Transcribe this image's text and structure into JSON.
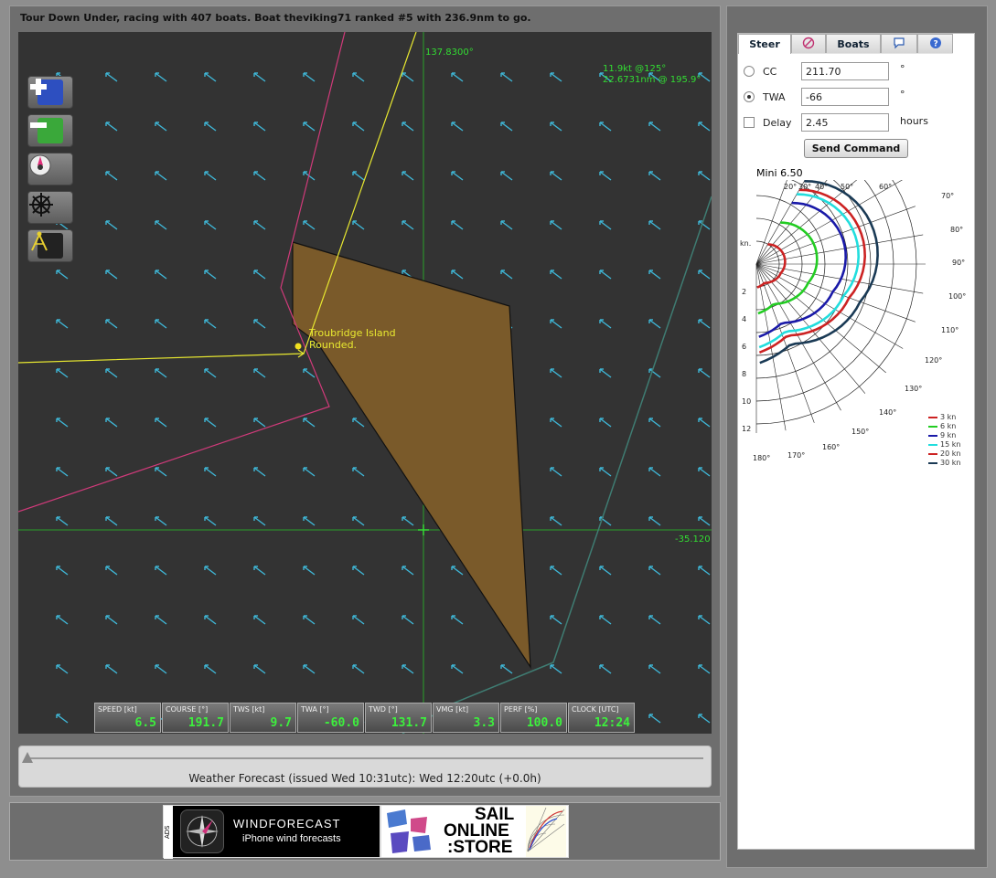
{
  "status": {
    "text": "Tour Down Under, racing with 407 boats. Boat theviking71 ranked #5 with 236.9nm to go."
  },
  "map": {
    "lon_label": "137.8300°",
    "lat_label": "-35.120",
    "wind_info_line1": "11.9kt @125°",
    "wind_info_line2": "22.6731nm @ 195.9°",
    "mark_label_line1": "Troubridge Island",
    "mark_label_line2": "Rounded.",
    "controls": [
      "zoom-in-icon",
      "zoom-out-icon",
      "compass-icon",
      "helm-wheel-icon",
      "divider-measure-icon"
    ]
  },
  "instruments": [
    {
      "label": "SPEED [kt]",
      "value": "6.5"
    },
    {
      "label": "COURSE [°]",
      "value": "191.7"
    },
    {
      "label": "TWS [kt]",
      "value": "9.7"
    },
    {
      "label": "TWA [°]",
      "value": "-60.0"
    },
    {
      "label": "TWD [°]",
      "value": "131.7"
    },
    {
      "label": "VMG [kt]",
      "value": "3.3"
    },
    {
      "label": "PERF [%]",
      "value": "100.0"
    },
    {
      "label": "CLOCK [UTC]",
      "value": "12:24"
    }
  ],
  "forecast": {
    "text": "Weather Forecast  (issued Wed 10:31utc): Wed 12:20utc  (+0.0h)"
  },
  "ads": {
    "wind_side_label": "ADS",
    "wind_title": "WINDFORECAST",
    "wind_subtitle": "iPhone wind forecasts",
    "sail_line1": "SAIL",
    "sail_line2": "ONLINE",
    "sail_line3": ":STORE"
  },
  "steer": {
    "tabs": {
      "steer": "Steer",
      "boats": "Boats"
    },
    "cc_label": "CC",
    "cc_value": "211.70",
    "twa_label": "TWA",
    "twa_value": "-66",
    "degree_unit": "°",
    "delay_label": "Delay",
    "delay_value": "2.45",
    "delay_unit": "hours",
    "send_button": "Send Command",
    "selected_mode": "TWA"
  },
  "polar": {
    "title": "Mini 6.50",
    "speed_axis_label": "kn.",
    "speed_ticks": [
      "2",
      "4",
      "6",
      "8",
      "10",
      "12"
    ],
    "angle_ticks": [
      "20°",
      "30°",
      "40°",
      "50°",
      "60°",
      "70°",
      "80°",
      "90°",
      "100°",
      "110°",
      "120°",
      "130°",
      "140°",
      "150°",
      "160°",
      "170°",
      "180°"
    ],
    "legend": [
      {
        "label": "3 kn",
        "color": "#cc2222"
      },
      {
        "label": "6 kn",
        "color": "#22cc22"
      },
      {
        "label": "9 kn",
        "color": "#1a1aa8"
      },
      {
        "label": "15 kn",
        "color": "#22dddd"
      },
      {
        "label": "20 kn",
        "color": "#cc2222"
      },
      {
        "label": "30 kn",
        "color": "#1a3a55"
      }
    ]
  }
}
